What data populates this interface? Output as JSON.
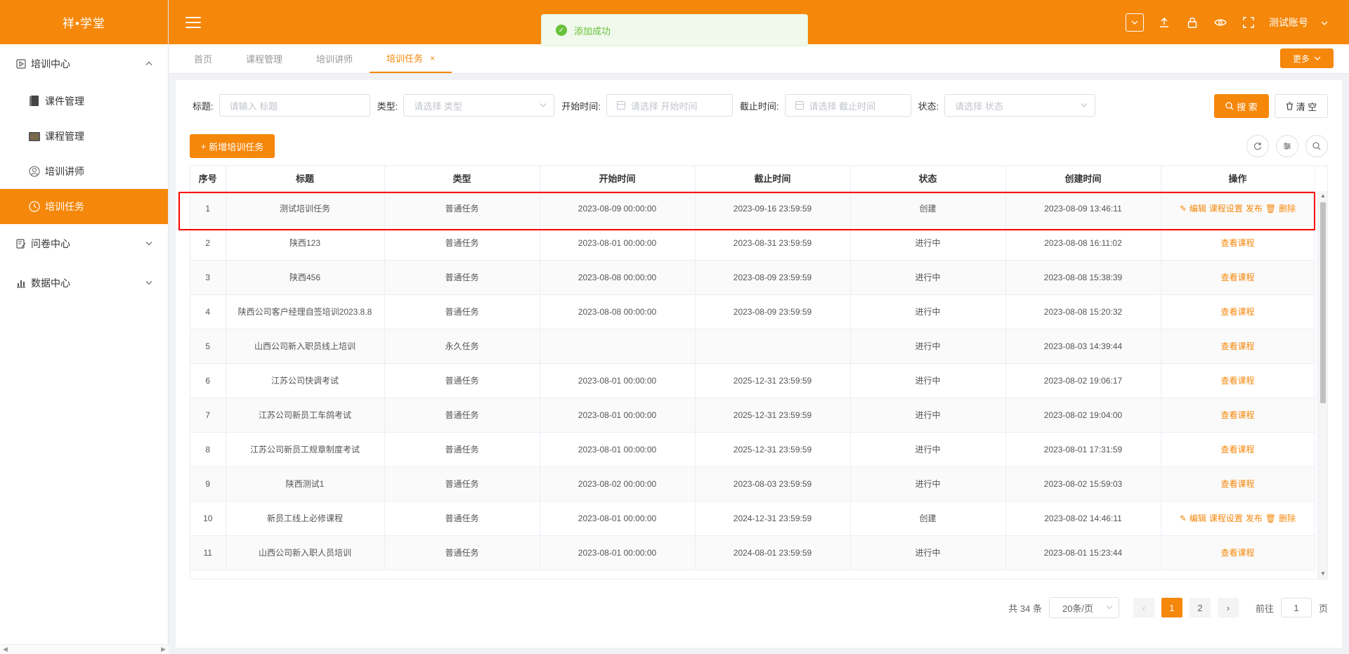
{
  "app": {
    "logo": "祥•学堂"
  },
  "sidebar": {
    "groups": [
      {
        "label": "培训中心",
        "icon": "play-doc-icon",
        "expanded": true,
        "items": [
          {
            "label": "课件管理",
            "icon": "book-icon"
          },
          {
            "label": "课程管理",
            "icon": "folder-book-icon"
          },
          {
            "label": "培训讲师",
            "icon": "user-icon"
          },
          {
            "label": "培训任务",
            "icon": "clock-icon",
            "active": true
          }
        ]
      },
      {
        "label": "问卷中心",
        "icon": "edit-doc-icon",
        "expanded": false
      },
      {
        "label": "数据中心",
        "icon": "bar-chart-icon",
        "expanded": false
      }
    ]
  },
  "header": {
    "user": "测试账号"
  },
  "toast": {
    "message": "添加成功"
  },
  "tabs": [
    {
      "label": "首页"
    },
    {
      "label": "课程管理"
    },
    {
      "label": "培训讲师"
    },
    {
      "label": "培训任务",
      "active": true,
      "close": "×"
    }
  ],
  "more_label": "更多",
  "filters": {
    "title_label": "标题:",
    "title_placeholder": "请输入 标题",
    "type_label": "类型:",
    "type_placeholder": "请选择 类型",
    "start_label": "开始时间:",
    "start_placeholder": "请选择 开始时间",
    "end_label": "截止时间:",
    "end_placeholder": "请选择 截止时间",
    "status_label": "状态:",
    "status_placeholder": "请选择 状态",
    "search_label": "搜 索",
    "clear_label": "清 空"
  },
  "add_label": "新增培训任务",
  "table": {
    "columns": [
      "序号",
      "标题",
      "类型",
      "开始时间",
      "截止时间",
      "状态",
      "创建时间",
      "操作"
    ],
    "rows": [
      {
        "no": "1",
        "title": "测试培训任务",
        "type": "普通任务",
        "start": "2023-08-09 00:00:00",
        "end": "2023-09-16 23:59:59",
        "status": "创建",
        "created": "2023-08-09 13:46:11",
        "ops": "full"
      },
      {
        "no": "2",
        "title": "陕西123",
        "type": "普通任务",
        "start": "2023-08-01 00:00:00",
        "end": "2023-08-31 23:59:59",
        "status": "进行中",
        "created": "2023-08-08 16:11:02",
        "ops": "view"
      },
      {
        "no": "3",
        "title": "陕西456",
        "type": "普通任务",
        "start": "2023-08-08 00:00:00",
        "end": "2023-08-09 23:59:59",
        "status": "进行中",
        "created": "2023-08-08 15:38:39",
        "ops": "view"
      },
      {
        "no": "4",
        "title": "陕西公司客户经理自签培训2023.8.8",
        "type": "普通任务",
        "start": "2023-08-08 00:00:00",
        "end": "2023-08-09 23:59:59",
        "status": "进行中",
        "created": "2023-08-08 15:20:32",
        "ops": "view"
      },
      {
        "no": "5",
        "title": "山西公司新入职员线上培训",
        "type": "永久任务",
        "start": "",
        "end": "",
        "status": "进行中",
        "created": "2023-08-03 14:39:44",
        "ops": "view"
      },
      {
        "no": "6",
        "title": "江苏公司快调考试",
        "type": "普通任务",
        "start": "2023-08-01 00:00:00",
        "end": "2025-12-31 23:59:59",
        "status": "进行中",
        "created": "2023-08-02 19:06:17",
        "ops": "view"
      },
      {
        "no": "7",
        "title": "江苏公司新员工车鸽考试",
        "type": "普通任务",
        "start": "2023-08-01 00:00:00",
        "end": "2025-12-31 23:59:59",
        "status": "进行中",
        "created": "2023-08-02 19:04:00",
        "ops": "view"
      },
      {
        "no": "8",
        "title": "江苏公司新员工规章制度考试",
        "type": "普通任务",
        "start": "2023-08-01 00:00:00",
        "end": "2025-12-31 23:59:59",
        "status": "进行中",
        "created": "2023-08-01 17:31:59",
        "ops": "view"
      },
      {
        "no": "9",
        "title": "陕西测试1",
        "type": "普通任务",
        "start": "2023-08-02 00:00:00",
        "end": "2023-08-03 23:59:59",
        "status": "进行中",
        "created": "2023-08-02 15:59:03",
        "ops": "view"
      },
      {
        "no": "10",
        "title": "新员工线上必修课程",
        "type": "普通任务",
        "start": "2023-08-01 00:00:00",
        "end": "2024-12-31 23:59:59",
        "status": "创建",
        "created": "2023-08-02 14:46:11",
        "ops": "full"
      },
      {
        "no": "11",
        "title": "山西公司新入职人员培训",
        "type": "普通任务",
        "start": "2023-08-01 00:00:00",
        "end": "2024-08-01 23:59:59",
        "status": "进行中",
        "created": "2023-08-01 15:23:44",
        "ops": "view"
      }
    ],
    "op_labels": {
      "edit": "编辑",
      "course_settings": "课程设置",
      "publish": "发布",
      "delete": "删除",
      "view": "查看课程"
    }
  },
  "pagination": {
    "total": "共 34 条",
    "page_size": "20条/页",
    "pages": [
      "1",
      "2"
    ],
    "current": "1",
    "goto_prefix": "前往",
    "goto_value": "1",
    "goto_suffix": "页"
  },
  "colors": {
    "accent": "#f5870a",
    "success": "#67c23a",
    "highlight": "#ff0000"
  }
}
